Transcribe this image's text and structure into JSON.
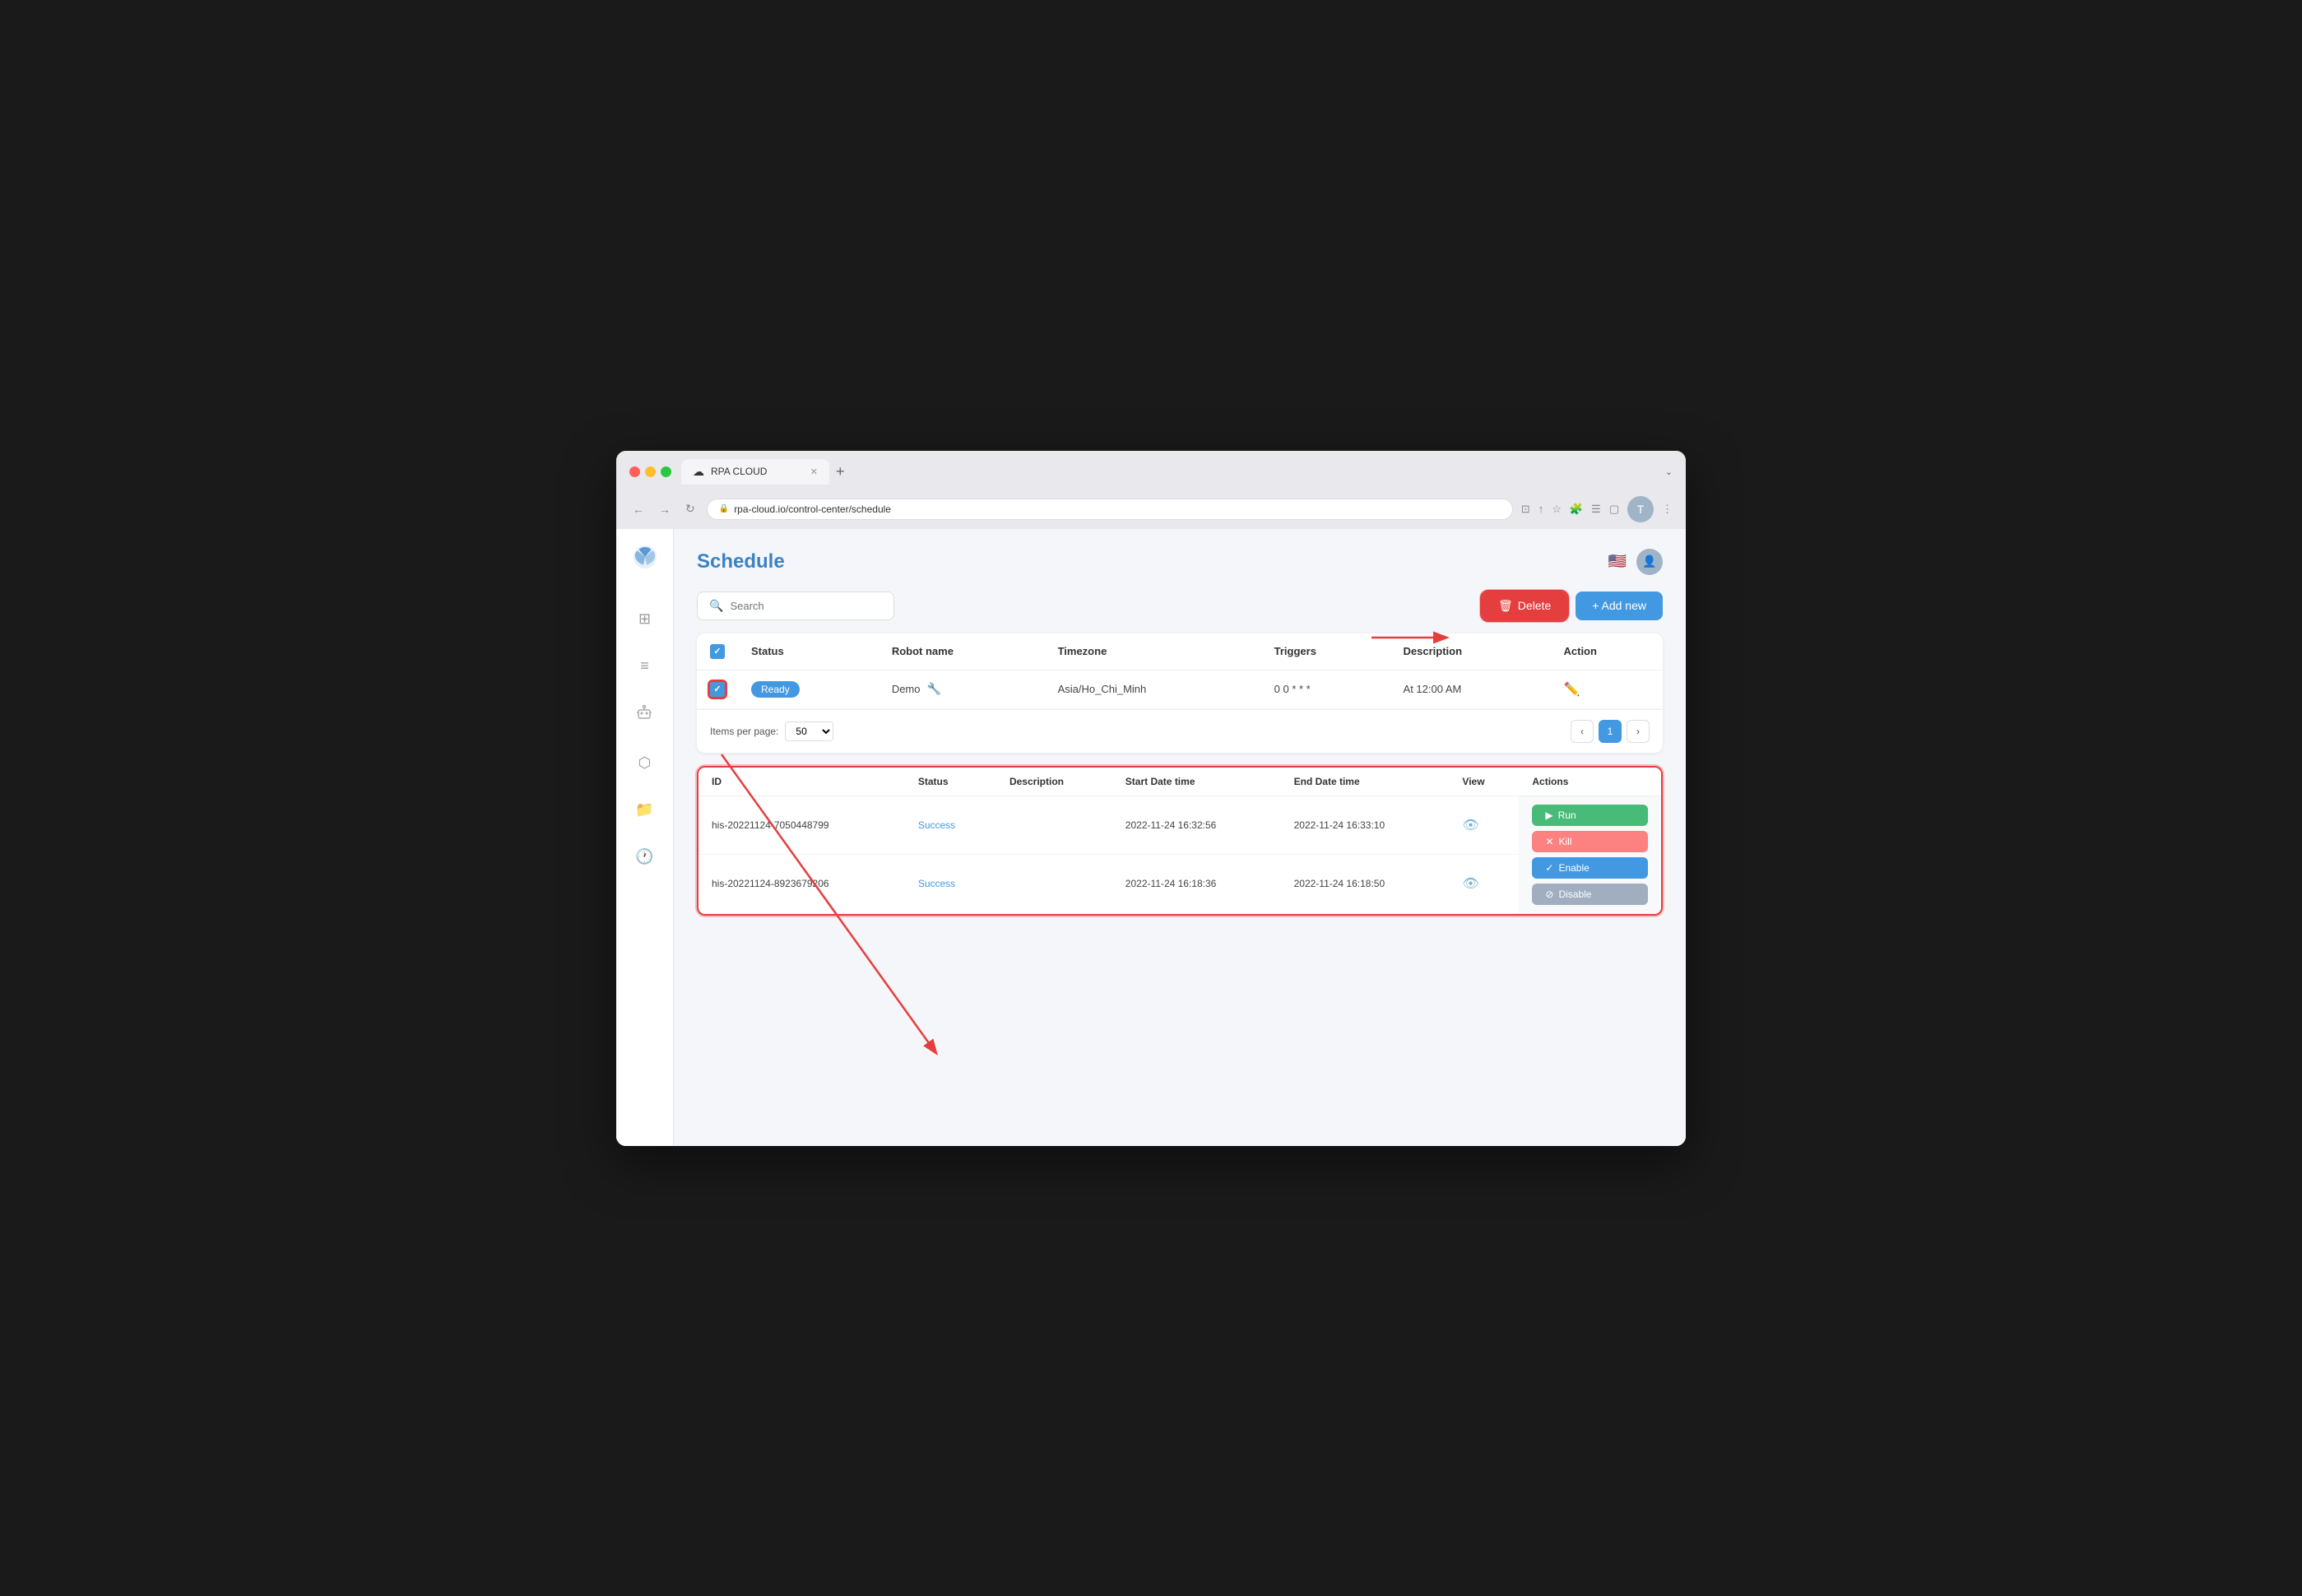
{
  "browser": {
    "url": "rpa-cloud.io/control-center/schedule",
    "tab_title": "RPA CLOUD",
    "tab_icon": "☁"
  },
  "page": {
    "title": "Schedule",
    "flag": "🇺🇸"
  },
  "toolbar": {
    "search_placeholder": "Search",
    "delete_label": "Delete",
    "add_new_label": "+ Add new"
  },
  "table": {
    "columns": [
      "",
      "Status",
      "Robot name",
      "Timezone",
      "Triggers",
      "Description",
      "Action"
    ],
    "rows": [
      {
        "checked": true,
        "status": "Ready",
        "robot_name": "Demo",
        "timezone": "Asia/Ho_Chi_Minh",
        "triggers": "0 0 * * *",
        "description": "At 12:00 AM"
      }
    ]
  },
  "pagination": {
    "items_per_page_label": "Items per page:",
    "items_per_page_value": "50",
    "current_page": 1
  },
  "history": {
    "columns": [
      "ID",
      "Status",
      "Description",
      "Start Date time",
      "End Date time",
      "View",
      "Actions"
    ],
    "rows": [
      {
        "id": "his-20221124-7050448799",
        "status": "Success",
        "description": "",
        "start": "2022-11-24 16:32:56",
        "end": "2022-11-24 16:33:10"
      },
      {
        "id": "his-20221124-8923679206",
        "status": "Success",
        "description": "",
        "start": "2022-11-24 16:18:36",
        "end": "2022-11-24 16:18:50"
      }
    ],
    "actions": {
      "run": "Run",
      "kill": "Kill",
      "enable": "Enable",
      "disable": "Disable"
    }
  },
  "sidebar": {
    "items": [
      {
        "icon": "⊞",
        "name": "dashboard"
      },
      {
        "icon": "≡",
        "name": "list"
      },
      {
        "icon": "⚡",
        "name": "robot"
      },
      {
        "icon": "⬡",
        "name": "network"
      },
      {
        "icon": "📁",
        "name": "files"
      },
      {
        "icon": "🕐",
        "name": "schedule"
      }
    ]
  }
}
